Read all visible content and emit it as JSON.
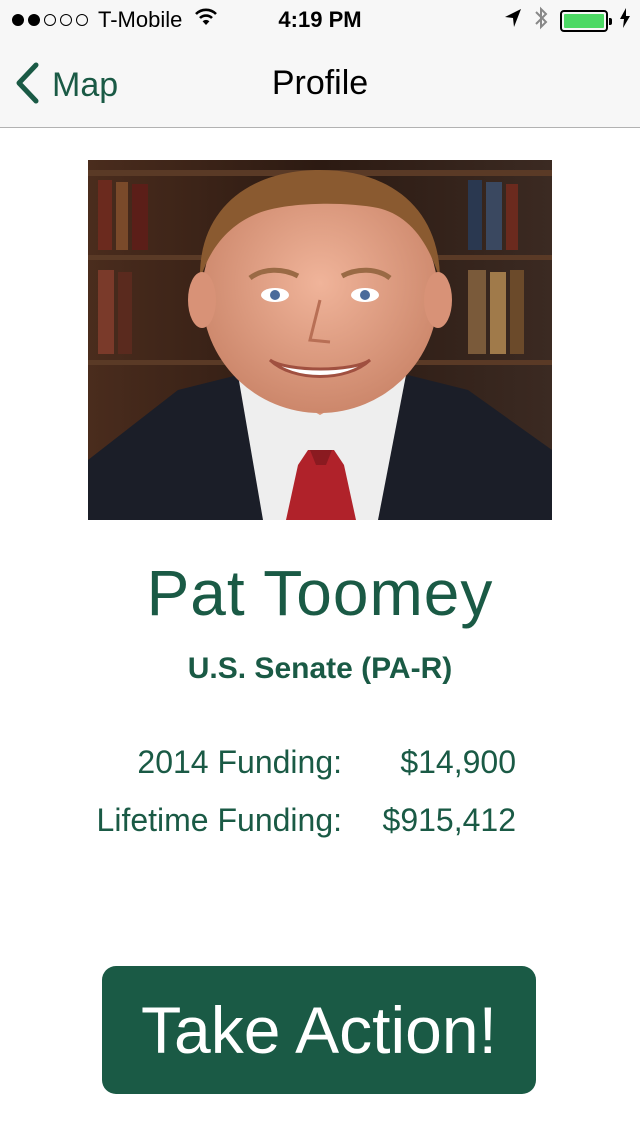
{
  "status_bar": {
    "carrier": "T-Mobile",
    "signal_bars_filled": 2,
    "signal_bars_total": 5,
    "time": "4:19 PM",
    "battery_level": 1.0
  },
  "nav": {
    "back_label": "Map",
    "title": "Profile"
  },
  "profile": {
    "name": "Pat Toomey",
    "office": "U.S. Senate (PA-R)",
    "funding": [
      {
        "label": "2014 Funding:",
        "value": "$14,900"
      },
      {
        "label": "Lifetime Funding:",
        "value": "$915,412"
      }
    ]
  },
  "action_button": {
    "label": "Take Action!"
  },
  "colors": {
    "accent": "#1a5a45",
    "battery": "#4cd964"
  },
  "icons": [
    "signal-dots-icon",
    "wifi-icon",
    "location-arrow-icon",
    "bluetooth-icon",
    "battery-icon",
    "charging-bolt-icon",
    "chevron-left-icon"
  ]
}
